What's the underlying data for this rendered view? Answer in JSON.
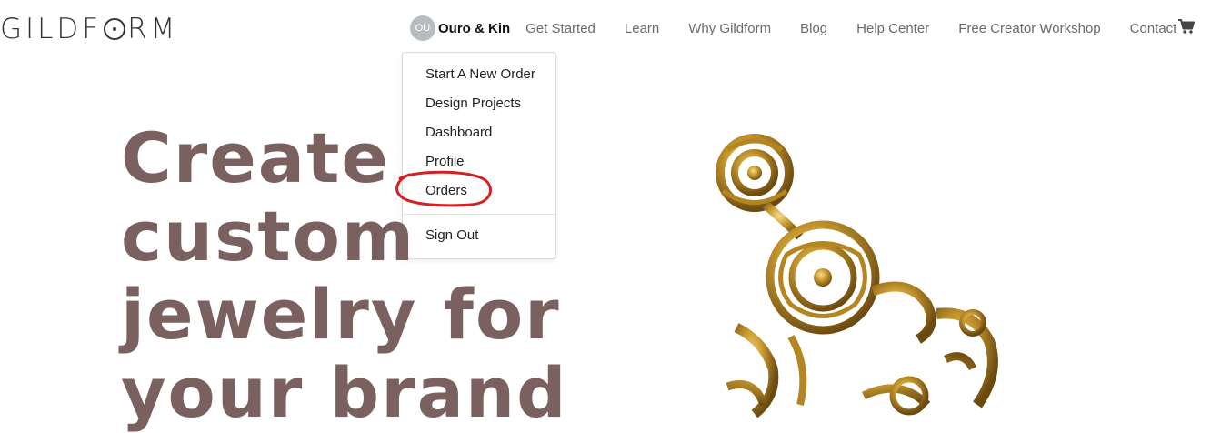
{
  "brand": {
    "logo_text_left": "GILDF",
    "logo_text_right": "RM"
  },
  "nav": {
    "user_initials": "OU",
    "user_name": "Ouro & Kin",
    "links": [
      "Get Started",
      "Learn",
      "Why Gildform",
      "Blog",
      "Help Center",
      "Free Creator Workshop",
      "Contact"
    ],
    "cart_icon": "shopping-cart-icon"
  },
  "dropdown": {
    "items": [
      "Start A New Order",
      "Design Projects",
      "Dashboard",
      "Profile",
      "Orders"
    ],
    "sign_out": "Sign Out"
  },
  "annotation": {
    "color": "#d42020",
    "target": "Orders"
  },
  "hero": {
    "lines": [
      "Create",
      "custom",
      "jewelry for",
      "your brand"
    ],
    "color": "#7a6160"
  },
  "colors": {
    "jewelry_gold": "#c8992e"
  }
}
